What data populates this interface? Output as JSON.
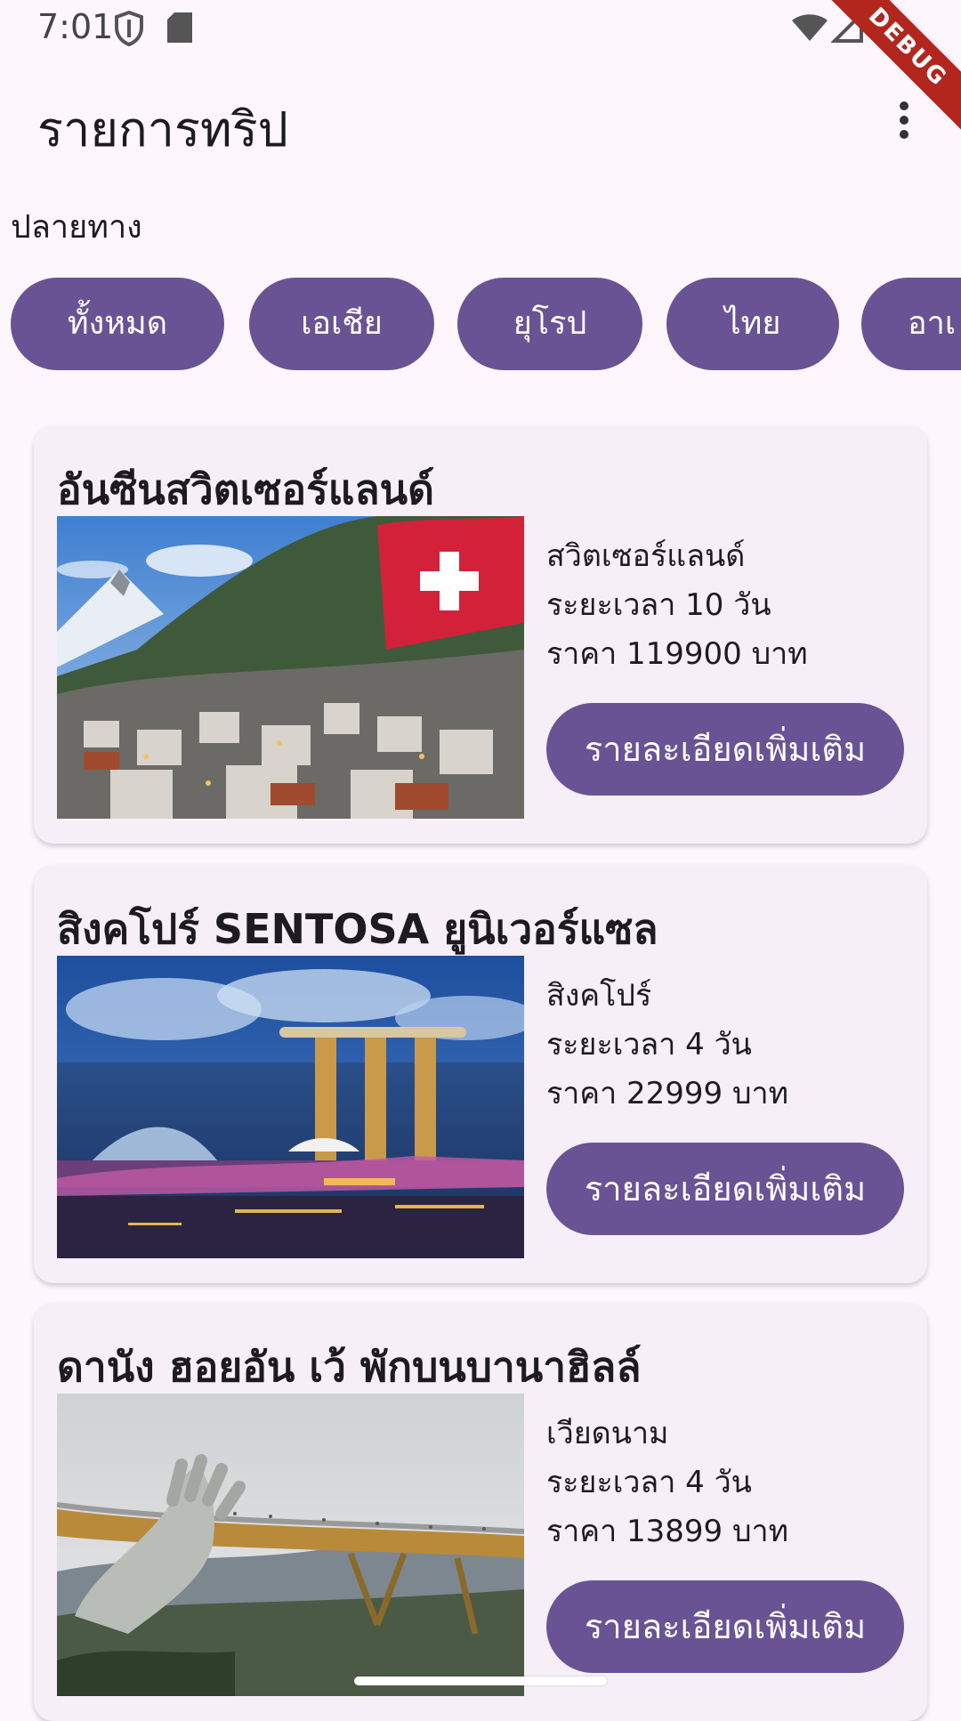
{
  "status_bar": {
    "time": "7:01",
    "debug_label": "DEBUG"
  },
  "app_bar": {
    "title": "รายการทริป"
  },
  "filter": {
    "label": "ปลายทาง",
    "chips": [
      "ทั้งหมด",
      "เอเชีย",
      "ยุโรป",
      "ไทย",
      "อาเ"
    ]
  },
  "trips": [
    {
      "title": "อันซีนสวิตเซอร์แลนด์",
      "country": "สวิตเซอร์แลนด์",
      "duration": "ระยะเวลา 10 วัน",
      "price": "ราคา 119900 บาท",
      "button": "รายละเอียดเพิ่มเติม",
      "image": "swiss-village-matterhorn-photo"
    },
    {
      "title": "สิงคโปร์ SENTOSA ยูนิเวอร์แซล",
      "country": "สิงคโปร์",
      "duration": "ระยะเวลา 4 วัน",
      "price": "ราคา 22999 บาท",
      "button": "รายละเอียดเพิ่มเติม",
      "image": "singapore-marina-bay-photo"
    },
    {
      "title": "ดานัง ฮอยอัน เว้ พักบนบานาฮิลล์",
      "country": "เวียดนาม",
      "duration": "ระยะเวลา 4 วัน",
      "price": "ราคา 13899 บาท",
      "button": "รายละเอียดเพิ่มเติม",
      "image": "golden-bridge-hands-photo"
    }
  ],
  "colors": {
    "primary": "#6a5394",
    "background": "#fdf7fd",
    "card": "#f6eff7"
  }
}
